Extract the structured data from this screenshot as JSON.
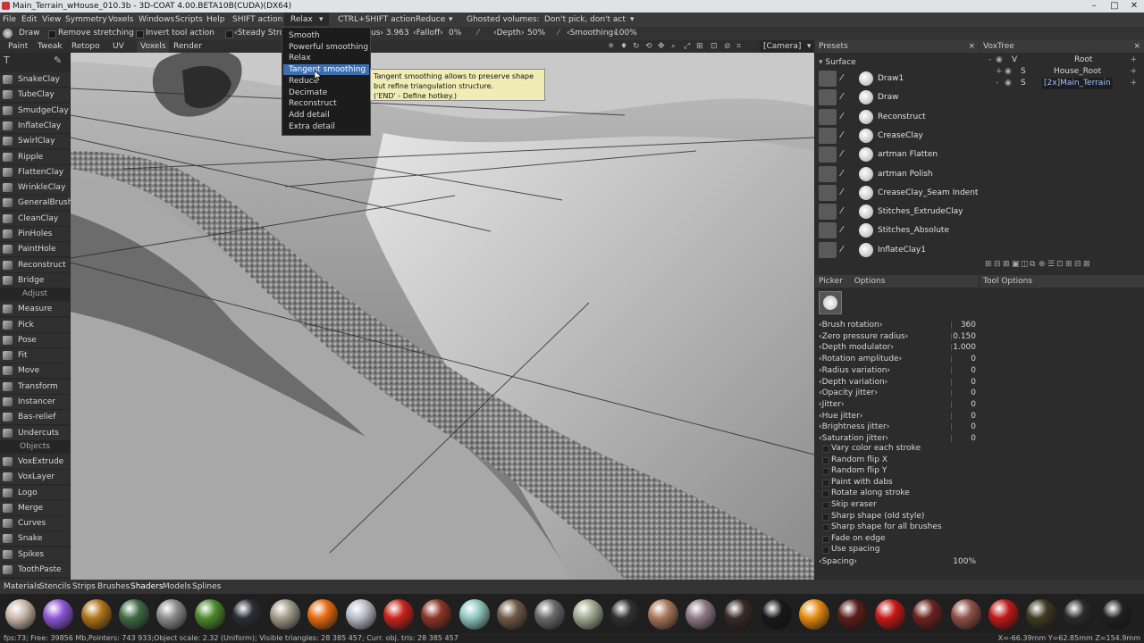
{
  "window": {
    "title": "Main_Terrain_wHouse_010.3b - 3D-COAT 4.00.BETA10B(CUDA)(DX64)",
    "controls": [
      "–",
      "□",
      "✕"
    ]
  },
  "menubar": {
    "items": [
      "File",
      "Edit",
      "View",
      "Symmetry",
      "Voxels",
      "Windows",
      "Scripts",
      "Help"
    ],
    "shift_label": "SHIFT action",
    "shift_value": "Relax",
    "ctrl_shift_label": "CTRL+SHIFT action",
    "ctrl_shift_value": "Reduce",
    "ghosted_label": "Ghosted volumes:",
    "ghosted_value": "Don't pick, don't act"
  },
  "toolbar": {
    "draw_label": "Draw",
    "remove_stretching": "Remove stretching",
    "invert_tool": "Invert tool action",
    "steady_stroke": "‹Steady Strok",
    "radius_value": "us› 3.963",
    "falloff": "‹Falloff›",
    "falloff_value": "0%",
    "depth": "‹Depth›",
    "depth_value": "50%",
    "smoothing": "‹Smoothing›",
    "smoothing_value": "100%",
    "camera": "[Camera]"
  },
  "rooms": [
    "Paint",
    "Tweak",
    "Retopo",
    "UV",
    "Voxels",
    "Render"
  ],
  "tools": {
    "items1": [
      "SnakeClay",
      "TubeClay",
      "SmudgeClay",
      "InflateClay",
      "SwirlClay",
      "Ripple",
      "FlattenClay",
      "WrinkleClay",
      "GeneralBrush",
      "CleanClay",
      "PinHoles",
      "PaintHole",
      "Reconstruct",
      "Bridge"
    ],
    "section_adjust": "Adjust",
    "items2": [
      "Measure",
      "Pick",
      "Pose",
      "Fit",
      "Move",
      "Transform",
      "Instancer",
      "Bas-relief",
      "Undercuts"
    ],
    "section_objects": "Objects",
    "items3": [
      "VoxExtrude",
      "VoxLayer",
      "Logo",
      "Merge",
      "Curves",
      "Snake",
      "Spikes",
      "ToothPaste"
    ]
  },
  "dropdown": {
    "items": [
      "Smooth",
      "Powerful smoothing",
      "Relax",
      "Tangent smoothing",
      "Reduce",
      "Decimate",
      "Reconstruct",
      "Add detail",
      "Extra detail"
    ],
    "selected": "Tangent smoothing"
  },
  "tooltip": {
    "line1": "Tangent smoothing allows to preserve shape",
    "line2": "but refine triangulation structure.",
    "line3": "('END' - Define hotkey.)"
  },
  "presets": {
    "title": "Presets",
    "group": "Surface",
    "items": [
      "Draw1",
      "Draw",
      "Reconstruct",
      "CreaseClay",
      "artman Flatten",
      "artman Polish",
      "CreaseClay_Seam Indent",
      "Stitches_ExtrudeClay",
      "Stitches_Absolute",
      "InflateClay1"
    ]
  },
  "voxtree": {
    "title": "VoxTree",
    "nodes": [
      "Root",
      "House_Root",
      "[2x]Main_Terrain"
    ]
  },
  "options": {
    "tab_picker": "Picker",
    "tab_options": "Options",
    "sliders": [
      {
        "label": "‹Brush rotation›",
        "value": "360"
      },
      {
        "label": "‹Zero pressure radius›",
        "value": "0.150"
      },
      {
        "label": "‹Depth modulator›",
        "value": "1.000"
      },
      {
        "label": "‹Rotation amplitude›",
        "value": "0"
      },
      {
        "label": "‹Radius variation›",
        "value": "0"
      },
      {
        "label": "‹Depth variation›",
        "value": "0"
      },
      {
        "label": "‹Opacity jitter›",
        "value": "0"
      },
      {
        "label": "‹Jitter›",
        "value": "0"
      },
      {
        "label": "‹Hue jitter›",
        "value": "0"
      },
      {
        "label": "‹Brightness jitter›",
        "value": "0"
      },
      {
        "label": "‹Saturation jitter›",
        "value": "0"
      }
    ],
    "checks": [
      "Vary color each stroke",
      "Random flip X",
      "Random flip Y",
      "Paint with dabs",
      "Rotate along stroke",
      "Skip eraser",
      "Sharp shape (old style)",
      "Sharp shape for all brushes",
      "Fade on edge",
      "Use spacing"
    ],
    "spacing_label": "‹Spacing›",
    "spacing_value": "100%"
  },
  "tool_options": {
    "title": "Tool Options"
  },
  "bottom_tabs": [
    "Materials",
    "Stencils",
    "Strips",
    "Brushes",
    "Shaders",
    "Models",
    "Splines"
  ],
  "materials_colors": [
    "#c9b8a8",
    "#8e55d6",
    "#b07418",
    "#3f6b46",
    "#8c8c8c",
    "#4d8a2c",
    "#2a2f35",
    "#a09a88",
    "#e66a10",
    "#b8bcc8",
    "#c8241c",
    "#8b3526",
    "#8fc6c0",
    "#6e5a46",
    "#6a6a6a",
    "#a2a88e",
    "#303030",
    "#a8765a",
    "#8e7884",
    "#3a2a26",
    "#181818",
    "#e48a10",
    "#5a1e18",
    "#c81818",
    "#6a2420",
    "#8e5046",
    "#c01818",
    "#3e3a22",
    "#2a2a2a",
    "#202020"
  ],
  "status": {
    "left": "fps:73;   Free: 39856 Mb,Pointers: 743 933;Object scale: 2.32 (Uniform); Visible triangles: 28 385 457; Curr. obj. tris: 28 385 457",
    "right": "X=-66.39mm Y=62.85mm Z=154.9mm"
  }
}
